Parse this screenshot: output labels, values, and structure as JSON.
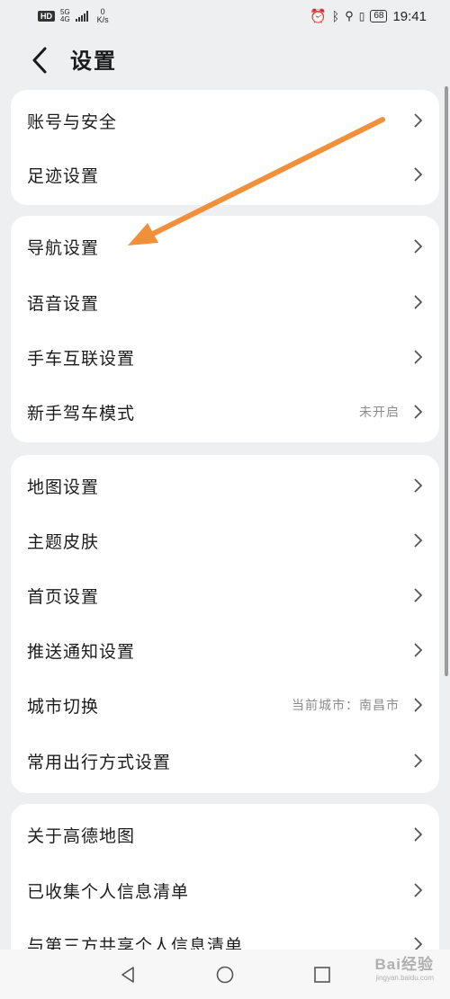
{
  "status_bar": {
    "hd": "HD",
    "network_top": "5G",
    "network_bottom": "4G",
    "speed_value": "0",
    "speed_unit": "K/s",
    "battery": "68",
    "time": "19:41"
  },
  "header": {
    "title": "设置"
  },
  "groups": [
    {
      "items": [
        {
          "label": "账号与安全",
          "value": ""
        },
        {
          "label": "足迹设置",
          "value": ""
        }
      ]
    },
    {
      "items": [
        {
          "label": "导航设置",
          "value": ""
        },
        {
          "label": "语音设置",
          "value": ""
        },
        {
          "label": "手车互联设置",
          "value": ""
        },
        {
          "label": "新手驾车模式",
          "value": "未开启"
        }
      ]
    },
    {
      "items": [
        {
          "label": "地图设置",
          "value": ""
        },
        {
          "label": "主题皮肤",
          "value": ""
        },
        {
          "label": "首页设置",
          "value": ""
        },
        {
          "label": "推送通知设置",
          "value": ""
        },
        {
          "label": "城市切换",
          "value": "当前城市：南昌市"
        },
        {
          "label": "常用出行方式设置",
          "value": ""
        }
      ]
    },
    {
      "items": [
        {
          "label": "关于高德地图",
          "value": ""
        },
        {
          "label": "已收集个人信息清单",
          "value": ""
        },
        {
          "label": "与第三方共享个人信息清单",
          "value": ""
        }
      ]
    }
  ],
  "annotation": {
    "color": "#f0903a"
  },
  "watermark": {
    "brand": "Bai经验",
    "domain": "jingyan.baidu.com"
  }
}
